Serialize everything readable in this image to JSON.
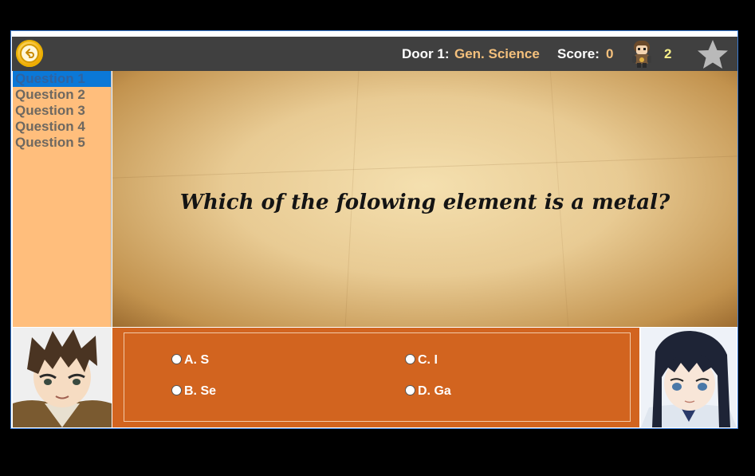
{
  "topbar": {
    "door_label": "Door 1:",
    "door_category": "Gen. Science",
    "score_label": "Score:",
    "score_value": "0",
    "lives_value": "2"
  },
  "sidebar": {
    "questions": [
      "Question 1",
      "Question 2",
      "Question 3",
      "Question 4",
      "Question 5"
    ],
    "active_index": 0
  },
  "question": {
    "text": "Which of the folowing element is a metal?"
  },
  "answers": [
    {
      "label": "A. S"
    },
    {
      "label": "B. Se"
    },
    {
      "label": "C. I"
    },
    {
      "label": "D. Ga"
    }
  ],
  "colors": {
    "topbar": "#404040",
    "sidebar": "#ffbe7c",
    "sidebar_active": "#0b78d7",
    "answers_panel": "#d2641f",
    "accent_text": "#f4c07c"
  },
  "icons": {
    "back": "back-arrow-icon",
    "star": "star-icon",
    "lives": "character-avatar-icon"
  }
}
